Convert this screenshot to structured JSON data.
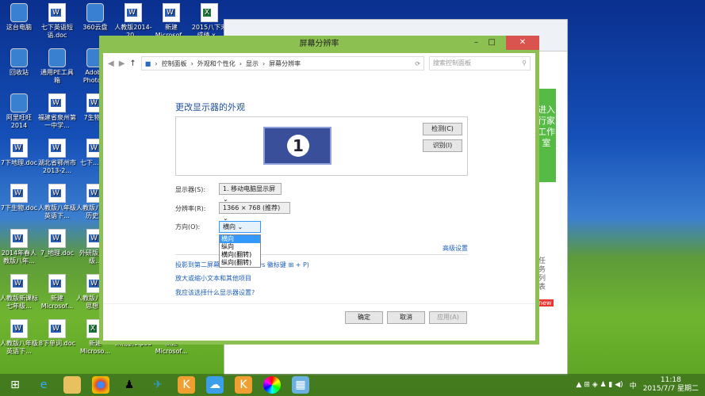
{
  "desktop": {
    "icons": [
      {
        "label": "这台电脑",
        "t": "o"
      },
      {
        "label": "七下英语短语.doc",
        "t": "w"
      },
      {
        "label": "360云盘",
        "t": "o"
      },
      {
        "label": "人教版2014-20...",
        "t": "w"
      },
      {
        "label": "新建Microsof...",
        "t": "w"
      },
      {
        "label": "2015八下末成绩.x...",
        "t": "x"
      },
      {
        "label": "回收站",
        "t": "o"
      },
      {
        "label": "通用PE工具箱",
        "t": "o"
      },
      {
        "label": "Adobe Photo...",
        "t": "o"
      },
      {
        "label": "阿里旺旺2014",
        "t": "o"
      },
      {
        "label": "福建省泉州第一中学...",
        "t": "w"
      },
      {
        "label": "7生物...",
        "t": "w"
      },
      {
        "label": "7下地理.doc",
        "t": "w"
      },
      {
        "label": "湖北省鄂州市2013-2...",
        "t": "w"
      },
      {
        "label": "七下...doc",
        "t": "w"
      },
      {
        "label": "7下生物.doc",
        "t": "w"
      },
      {
        "label": "人教版八年级英语下...",
        "t": "w"
      },
      {
        "label": "人教版八年级历史...",
        "t": "w"
      },
      {
        "label": "2014年春人教版八年...",
        "t": "w"
      },
      {
        "label": "7_地理.doc",
        "t": "w"
      },
      {
        "label": "外研版五年级...",
        "t": "w"
      },
      {
        "label": "人教版新课标七年级...",
        "t": "w"
      },
      {
        "label": "新建Microsof...",
        "t": "w"
      },
      {
        "label": "人教版八年级思想...",
        "t": "w"
      },
      {
        "label": "人教版八年级英语下...",
        "t": "w"
      },
      {
        "label": "8下单词.doc",
        "t": "w"
      },
      {
        "label": "新建Microso...",
        "t": "x"
      },
      {
        "label": "宋杨鹏1.psd",
        "t": "o"
      },
      {
        "label": "新建Microsof...",
        "t": "w"
      }
    ]
  },
  "browser": {
    "side_banner": "进入行家工作室",
    "task_list": "任务列表",
    "new_badge": "new"
  },
  "window": {
    "title": "屏幕分辨率",
    "minimize": "–",
    "maximize": "□",
    "close": "✕",
    "breadcrumb": [
      "控制面板",
      "外观和个性化",
      "显示",
      "屏幕分辨率"
    ],
    "search_placeholder": "搜索控制面板",
    "heading": "更改显示器的外观",
    "monitor_number": "1",
    "detect": "检测(C)",
    "identify": "识别(I)",
    "display_label": "显示器(S):",
    "display_value": "1. 移动电脑显示屏",
    "resolution_label": "分辨率(R):",
    "resolution_value": "1366 × 768 (推荐)",
    "orientation_label": "方向(O):",
    "orientation_value": "横向",
    "orientation_options": [
      "横向",
      "纵向",
      "横向(翻转)",
      "纵向(翻转)"
    ],
    "advanced": "高级设置",
    "link_project": "投影到第二屏幕(或按 Windows 徽标键 ⊞ + P)",
    "link_text_size": "放大或缩小文本和其他项目",
    "link_help": "我应该选择什么显示器设置?",
    "ok": "确定",
    "cancel": "取消",
    "apply": "应用(A)"
  },
  "taskbar": {
    "time": "11:18",
    "date": "2015/7/7 星期二",
    "ime": "中"
  }
}
